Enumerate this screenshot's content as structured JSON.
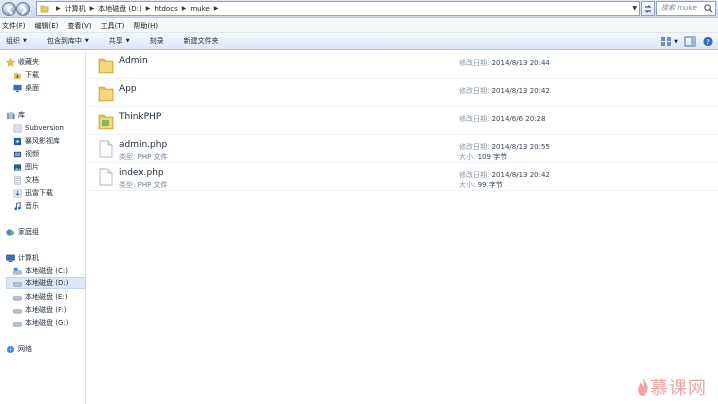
{
  "address": {
    "crumbs": [
      "计算机",
      "本地磁盘 (D:)",
      "htdocs",
      "muke"
    ],
    "search_placeholder": "搜索 muke"
  },
  "menu": [
    "文件(F)",
    "编辑(E)",
    "查看(V)",
    "工具(T)",
    "帮助(H)"
  ],
  "toolbar": {
    "organize": "组织",
    "include_library": "包含到库中",
    "share": "共享",
    "burn": "刻录",
    "new_folder": "新建文件夹"
  },
  "sidebar": {
    "favorites": "收藏夹",
    "downloads": "下载",
    "desktop": "桌面",
    "library": "库",
    "subversion": "Subversion",
    "baofeng": "暴风影视库",
    "videos": "视频",
    "pictures": "图片",
    "documents": "文档",
    "xunlei": "迅雷下载",
    "music": "音乐",
    "homegroup": "家庭组",
    "computer": "计算机",
    "drive_c": "本地磁盘 (C:)",
    "drive_d": "本地磁盘 (D:)",
    "drive_e": "本地磁盘 (E:)",
    "drive_f": "本地磁盘 (F:)",
    "drive_g": "本地磁盘 (G:)",
    "network": "网络"
  },
  "labels": {
    "modified": "修改日期:",
    "type": "类型:",
    "size": "大小:"
  },
  "files": [
    {
      "name": "Admin",
      "kind": "folder",
      "modified": "2014/8/13 20:44",
      "type": "",
      "size": ""
    },
    {
      "name": "App",
      "kind": "folder",
      "modified": "2014/8/13 20:42",
      "type": "",
      "size": ""
    },
    {
      "name": "ThinkPHP",
      "kind": "folder-special",
      "modified": "2014/6/6 20:28",
      "type": "",
      "size": ""
    },
    {
      "name": "admin.php",
      "kind": "file",
      "modified": "2014/8/13 20:55",
      "type": "PHP 文件",
      "size": "109 字节"
    },
    {
      "name": "index.php",
      "kind": "file",
      "modified": "2014/8/13 20:42",
      "type": "PHP 文件",
      "size": "99 字节"
    }
  ],
  "watermark": "慕课网",
  "colors": {
    "selection": "#dde8f6",
    "folder": "#e8c25a",
    "watermark": "#f0a5a5"
  }
}
